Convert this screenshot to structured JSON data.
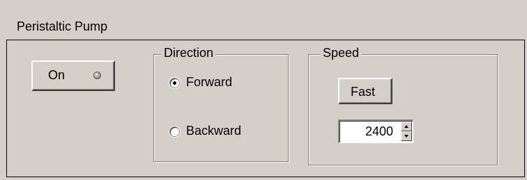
{
  "panel": {
    "title": "Peristaltic Pump"
  },
  "power": {
    "label": "On",
    "indicator_icon": "led-indicator-icon",
    "indicator_state": "off"
  },
  "direction": {
    "legend": "Direction",
    "options": [
      {
        "label": "Forward",
        "checked": true
      },
      {
        "label": "Backward",
        "checked": false
      }
    ]
  },
  "speed": {
    "legend": "Speed",
    "mode_button": "Fast",
    "value": "2400",
    "up_icon": "spin-up-arrow-icon",
    "down_icon": "spin-down-arrow-icon"
  },
  "colors": {
    "background": "#d4d0c8",
    "field": "#ffffff"
  }
}
